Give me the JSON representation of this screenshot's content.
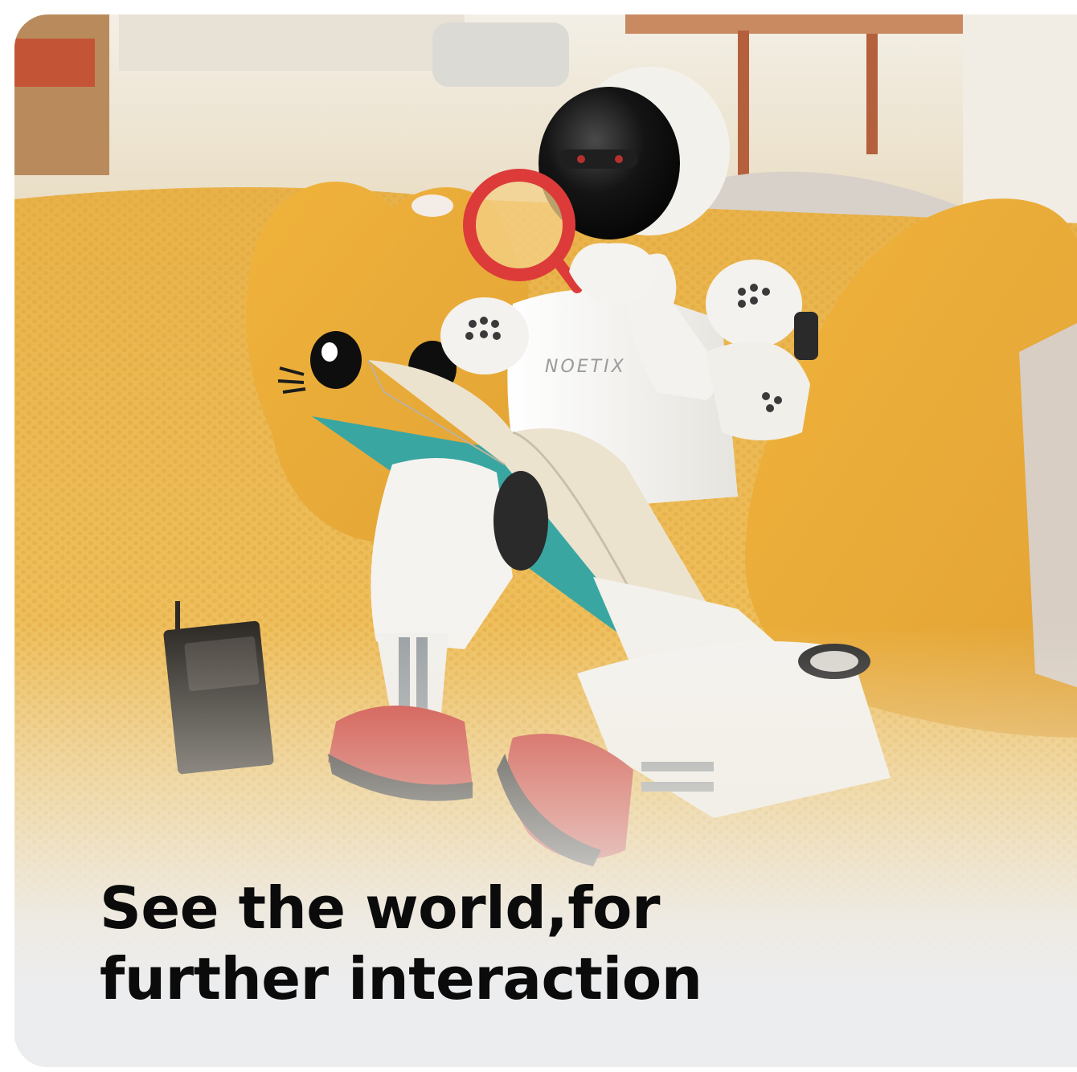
{
  "photo": {
    "description_icon": "robot-reading-photo",
    "brand_mark": "NOETIX"
  },
  "headline": {
    "line1": "See the world,for",
    "line2": "further interaction"
  },
  "colors": {
    "background": "#ecedef",
    "headline": "#0b0b0b",
    "sofa": "#e7b44a",
    "robot_body": "#f4f3ef",
    "robot_head": "#151515",
    "accent_red": "#d8393a"
  }
}
